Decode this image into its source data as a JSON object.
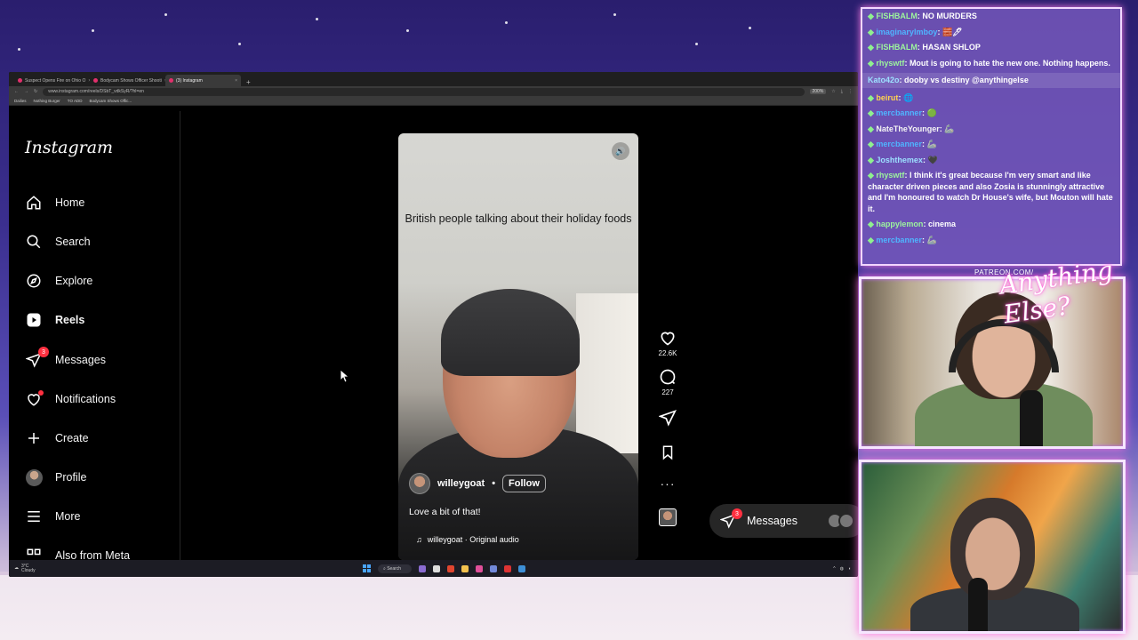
{
  "browser": {
    "tabs": [
      {
        "label": "Suspect Opens Fire on Ohio O",
        "active": false
      },
      {
        "label": "Bodycam Shows Officer Shooti",
        "active": false
      },
      {
        "label": "(3) Instagram",
        "active": true
      }
    ],
    "url": "www.instagram.com/reels/DSbT_vdkSyR/?hl=en",
    "zoom": "200%",
    "bookmarks": [
      "Dailies",
      "Nothing Burger",
      "TO ADD",
      "Bodycam Shows Offic..."
    ]
  },
  "instagram": {
    "logo": "Instagram",
    "nav": [
      {
        "id": "home",
        "label": "Home",
        "icon": "home-icon"
      },
      {
        "id": "search",
        "label": "Search",
        "icon": "search-icon"
      },
      {
        "id": "explore",
        "label": "Explore",
        "icon": "compass-icon"
      },
      {
        "id": "reels",
        "label": "Reels",
        "icon": "reels-icon"
      },
      {
        "id": "messages",
        "label": "Messages",
        "icon": "paper-plane-icon",
        "badge": "3"
      },
      {
        "id": "notifications",
        "label": "Notifications",
        "icon": "heart-icon"
      },
      {
        "id": "create",
        "label": "Create",
        "icon": "plus-icon"
      },
      {
        "id": "profile",
        "label": "Profile",
        "icon": "avatar"
      },
      {
        "id": "more",
        "label": "More",
        "icon": "hamburger-icon"
      },
      {
        "id": "meta",
        "label": "Also from Meta",
        "icon": "meta-icon"
      }
    ],
    "reel": {
      "overlay_text": "British people talking about their holiday foods",
      "username": "willeygoat",
      "follow_label": "Follow",
      "caption": "Love a bit of that!",
      "audio": "willeygoat · Original audio",
      "likes": "22.6K",
      "comments": "227"
    },
    "floating_messages": {
      "label": "Messages",
      "badge": "3"
    }
  },
  "taskbar": {
    "weather_temp": "3°C",
    "weather_desc": "Cloudy",
    "search_label": "Search"
  },
  "chat": [
    {
      "user": "FISHBALM",
      "msg": "NO MURDERS",
      "user_color": "#9df59d"
    },
    {
      "user": "imaginarylmboy",
      "msg": "🧱🖊",
      "user_color": "#4fb5ff"
    },
    {
      "user": "FISHBALM",
      "msg": "HASAN SHLOP",
      "user_color": "#9df59d"
    },
    {
      "user": "rhyswtf",
      "msg": "Mout is going to hate the new one. Nothing happens.",
      "user_color": "#9df59d"
    },
    {
      "user": "Kato42o",
      "msg": "dooby vs destiny @anythingelse",
      "user_color": "#9de0ff",
      "highlight": true
    },
    {
      "user": "beirut",
      "msg": "🌐",
      "user_color": "#ffd24f"
    },
    {
      "user": "mercbanner",
      "msg": "🟢",
      "user_color": "#4fb5ff"
    },
    {
      "user": "NateTheYounger",
      "msg": "🦾",
      "user_color": "#f4f4f4"
    },
    {
      "user": "mercbanner",
      "msg": "🦾",
      "user_color": "#4fb5ff"
    },
    {
      "user": "Joshthemex",
      "msg": "🖤",
      "user_color": "#9de0ff"
    },
    {
      "user": "rhyswtf",
      "msg": "I think it's great because I'm very smart and like character driven pieces and also Zosia is stunningly attractive and I'm honoured to watch Dr House's wife, but Mouton will hate it.",
      "user_color": "#9df59d"
    },
    {
      "user": "happylemon",
      "msg": "cinema",
      "user_color": "#9df59d"
    },
    {
      "user": "mercbanner",
      "msg": "🦾",
      "user_color": "#4fb5ff"
    }
  ],
  "overlay": {
    "patreon": "PATREON.COM/",
    "signature": "Anything Else?"
  }
}
